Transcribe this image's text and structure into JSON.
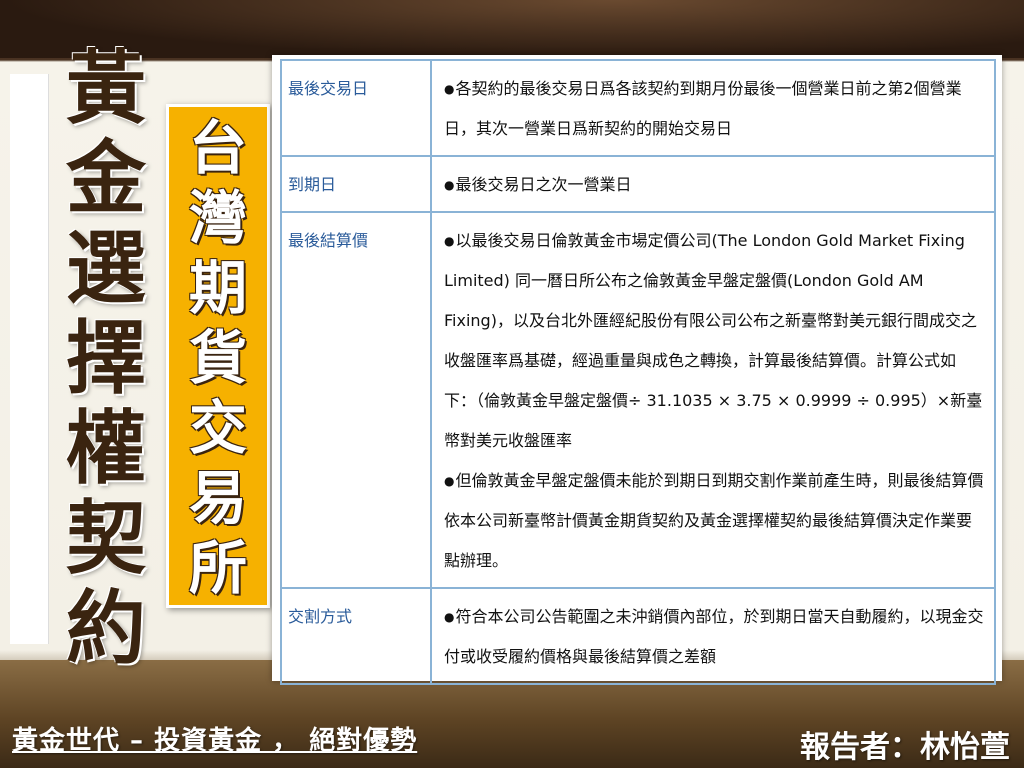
{
  "slide": {
    "main_title": "黃金選擇權契約",
    "sub_title": "台灣期貨交易所",
    "footer_left": "黃金世代 – 投資黃金 ， 絕對優勢",
    "footer_right": "報告者：林怡萱"
  },
  "table": {
    "rows": [
      {
        "label": "最後交易日",
        "paragraphs": [
          "各契約的最後交易日爲各該契約到期月份最後一個營業日前之第2個營業日，其次一營業日爲新契約的開始交易日"
        ]
      },
      {
        "label": "到期日",
        "paragraphs": [
          "最後交易日之次一營業日"
        ]
      },
      {
        "label": "最後結算價",
        "paragraphs": [
          "以最後交易日倫敦黃金市場定價公司(The London Gold Market Fixing Limited) 同一曆日所公布之倫敦黃金早盤定盤價(London Gold AM Fixing)，以及台北外匯經紀股份有限公司公布之新臺幣對美元銀行間成交之收盤匯率爲基礎，經過重量與成色之轉換，計算最後結算價。計算公式如下：（倫敦黃金早盤定盤價÷ 31.1035 × 3.75 × 0.9999 ÷ 0.995）×新臺幣對美元收盤匯率",
          "但倫敦黃金早盤定盤價未能於到期日到期交割作業前產生時，則最後結算價依本公司新臺幣計價黃金期貨契約及黃金選擇權契約最後結算價決定作業要點辦理。"
        ]
      },
      {
        "label": "交割方式",
        "paragraphs": [
          "符合本公司公告範圍之未沖銷價內部位，於到期日當天自動履約，以現金交付或收受履約價格與最後結算價之差額"
        ]
      }
    ]
  }
}
